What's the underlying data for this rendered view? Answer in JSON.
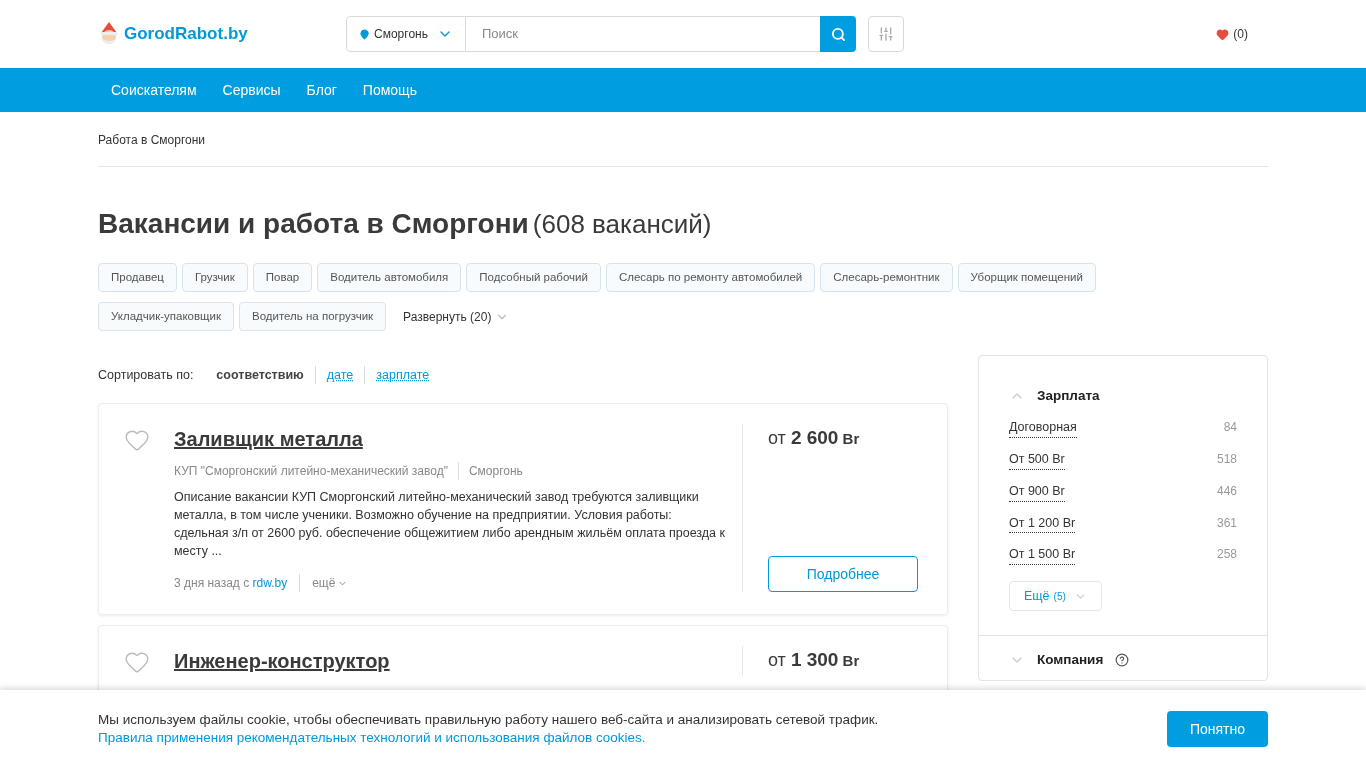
{
  "header": {
    "logo": "GorodRabot.by",
    "city": "Сморгонь",
    "search": {
      "placeholder": "Поиск"
    },
    "favorites": "(0)"
  },
  "nav": [
    "Соискателям",
    "Сервисы",
    "Блог",
    "Помощь"
  ],
  "breadcrumb": "Работа в Сморгони",
  "title": "Вакансии и работа в Сморгони",
  "count": "(608 вакансий)",
  "tags": [
    "Продавец",
    "Грузчик",
    "Повар",
    "Водитель автомобиля",
    "Подсобный рабочий",
    "Слесарь по ремонту автомобилей",
    "Слесарь-ремонтник",
    "Уборщик помещений",
    "Укладчик-упаковщик",
    "Водитель на погрузчик"
  ],
  "expand": "Развернуть (20)",
  "sort": {
    "label": "Сортировать по:",
    "options": [
      {
        "label": "соответствию",
        "selected": true
      },
      {
        "label": "дате",
        "selected": false
      },
      {
        "label": "зарплате",
        "selected": false
      }
    ]
  },
  "vacancies": [
    {
      "title": "Заливщик металла",
      "company": "КУП \"Сморгонский литейно-механический завод\"",
      "city": "Сморгонь",
      "description": "Описание вакансии КУП Сморгонский литейно-механический завод требуются заливщики металла, в том числе ученики. Возможно обучение на предприятии. Условия работы: сдельная з/п от 2600 руб. обеспечение общежитием либо арендным жильём оплата проезда к месту ...",
      "posted": "3 дня назад с",
      "source": "rdw.by",
      "more": "ещё",
      "salary_prefix": "от",
      "salary": "2 600",
      "currency": "Br",
      "button": "Подробнее"
    },
    {
      "title": "Инженер-конструктор",
      "salary_prefix": "от",
      "salary": "1 300",
      "currency": "Br"
    }
  ],
  "filters": [
    {
      "title": "Зарплата",
      "expanded": true,
      "items": [
        {
          "label": "Договорная",
          "count": "84"
        },
        {
          "label": "От 500 Br",
          "count": "518"
        },
        {
          "label": "От 900 Br",
          "count": "446"
        },
        {
          "label": "От 1 200 Br",
          "count": "361"
        },
        {
          "label": "От 1 500 Br",
          "count": "258"
        }
      ],
      "more": "Ещё",
      "more_count": "(5)"
    },
    {
      "title": "Компания",
      "expanded": false
    }
  ],
  "cookie": {
    "text": "Мы используем файлы cookie, чтобы обеспечивать правильную работу нашего веб-сайта и анализировать сетевой трафик.",
    "link": "Правила применения рекомендательных технологий и использования файлов cookies.",
    "button": "Понятно"
  }
}
